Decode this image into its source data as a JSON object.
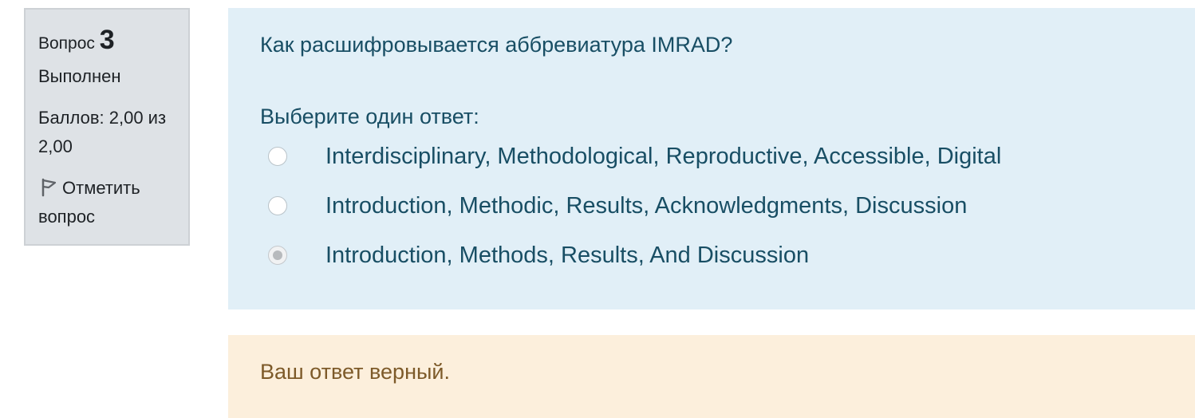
{
  "info": {
    "question_label": "Вопрос",
    "question_number": "3",
    "state": "Выполнен",
    "grade": "Баллов: 2,00 из 2,00",
    "flag_label": "Отметить вопрос",
    "flag_icon": "flag-icon"
  },
  "question": {
    "text": "Как расшифровывается аббревиатура IMRAD?",
    "prompt": "Выберите один ответ:",
    "answers": [
      {
        "label": "Interdisciplinary, Methodological, Reproductive, Accessible, Digital",
        "selected": false
      },
      {
        "label": "Introduction, Methodic, Results, Acknowledgments, Discussion",
        "selected": false
      },
      {
        "label": "Introduction, Methods, Results, And Discussion",
        "selected": true
      }
    ]
  },
  "feedback": {
    "text": "Ваш ответ верный."
  },
  "colors": {
    "info_background": "#dee2e6",
    "question_background": "#e1eff7",
    "question_text": "#184e64",
    "feedback_background": "#fcefdc",
    "feedback_text": "#7d5a29"
  }
}
